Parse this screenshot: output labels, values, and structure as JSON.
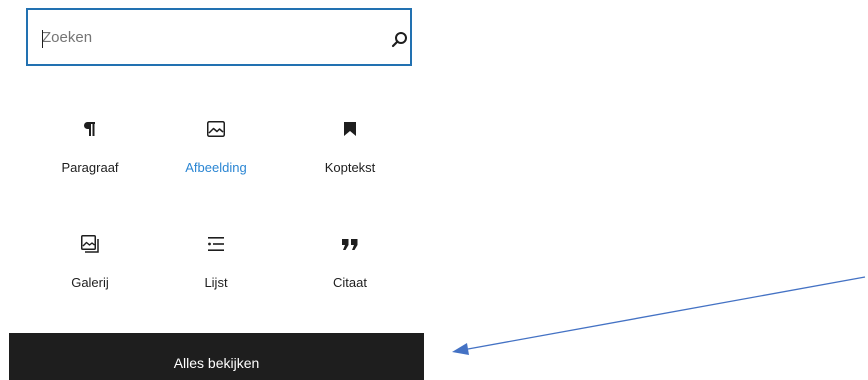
{
  "search": {
    "placeholder": "Zoeken",
    "value": "",
    "icon": "search-icon"
  },
  "blocks": [
    {
      "label": "Paragraaf",
      "icon": "paragraph-icon"
    },
    {
      "label": "Afbeelding",
      "icon": "image-icon",
      "active": true
    },
    {
      "label": "Koptekst",
      "icon": "bookmark-icon"
    },
    {
      "label": "Galerij",
      "icon": "gallery-icon"
    },
    {
      "label": "Lijst",
      "icon": "list-icon"
    },
    {
      "label": "Citaat",
      "icon": "quote-icon"
    }
  ],
  "footer": {
    "label": "Alles bekijken"
  },
  "colors": {
    "accent": "#2271b1",
    "active_label": "#2b86d3",
    "footer_bg": "#1e1e1e",
    "annotation_arrow": "#4472c4"
  }
}
